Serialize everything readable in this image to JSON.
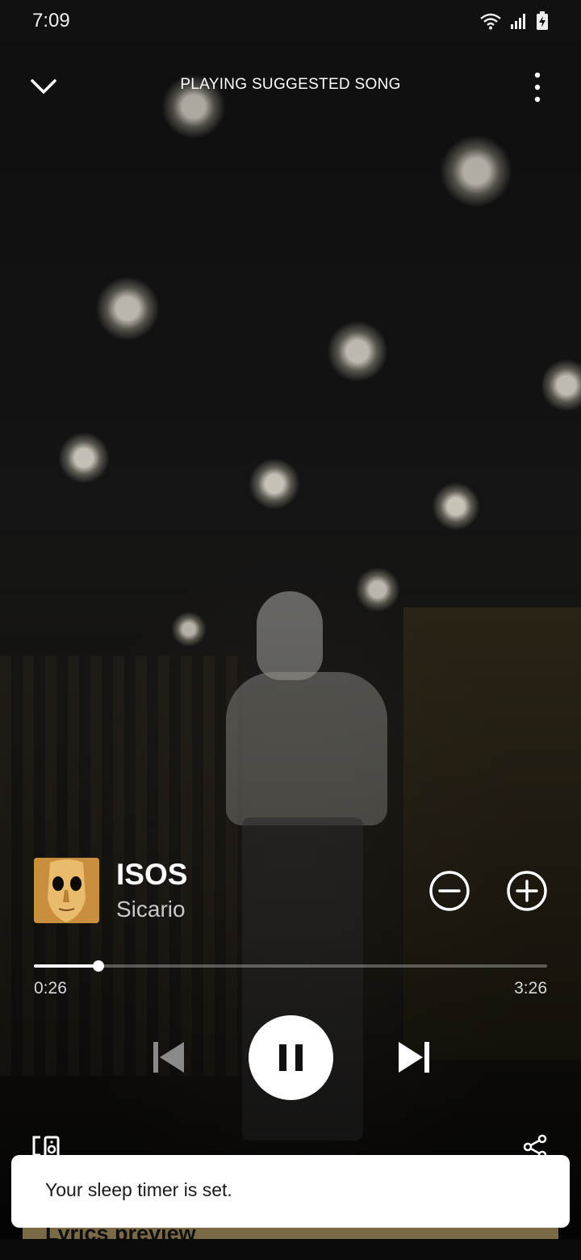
{
  "status_bar": {
    "time": "7:09",
    "icons": [
      "wifi-icon",
      "signal-icon",
      "battery-charging-icon"
    ]
  },
  "header": {
    "title": "PLAYING SUGGESTED SONG",
    "left_icon": "chevron-down-icon",
    "right_icon": "more-vertical-icon"
  },
  "track": {
    "title": "ISOS",
    "artist": "Sicario"
  },
  "progress": {
    "elapsed": "0:26",
    "total": "3:26",
    "fraction": 0.126
  },
  "controls": {
    "previous_icon": "skip-previous-icon",
    "play_pause_icon": "pause-icon",
    "next_icon": "skip-next-icon",
    "remove_icon": "minus-circle-icon",
    "add_icon": "plus-circle-icon",
    "devices_icon": "devices-icon",
    "share_icon": "share-icon",
    "previous_disabled": true
  },
  "lyrics": {
    "label": "Lyrics preview"
  },
  "toast": {
    "message": "Your sleep timer is set."
  },
  "colors": {
    "accent": "#ffffff",
    "lyrics_card": "#7b6a48",
    "toast_bg": "#ffffff"
  }
}
